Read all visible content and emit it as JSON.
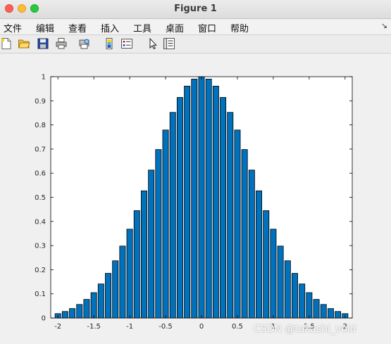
{
  "window": {
    "title": "Figure 1"
  },
  "menubar": {
    "items": [
      "文件",
      "编辑",
      "查看",
      "插入",
      "工具",
      "桌面",
      "窗口",
      "帮助"
    ],
    "dock_glyph": "↘"
  },
  "toolbar": {
    "buttons": [
      "new-figure-icon",
      "open-folder-icon",
      "save-icon",
      "print-icon",
      "print-preview-icon",
      "link-plot-icon",
      "insert-legend-icon",
      "pointer-icon",
      "property-inspector-icon"
    ]
  },
  "colors": {
    "bar_fill": "#0072bd",
    "bar_edge": "#000000",
    "axes_background": "#ffffff",
    "figure_background": "#f0f0f0"
  },
  "chart_data": {
    "type": "bar",
    "x": [
      -2.0,
      -1.9,
      -1.8,
      -1.7,
      -1.6,
      -1.5,
      -1.4,
      -1.3,
      -1.2,
      -1.1,
      -1.0,
      -0.9,
      -0.8,
      -0.7,
      -0.6,
      -0.5,
      -0.4,
      -0.3,
      -0.2,
      -0.1,
      0.0,
      0.1,
      0.2,
      0.3,
      0.4,
      0.5,
      0.6,
      0.7,
      0.8,
      0.9,
      1.0,
      1.1,
      1.2,
      1.3,
      1.4,
      1.5,
      1.6,
      1.7,
      1.8,
      1.9,
      2.0
    ],
    "values": [
      0.018,
      0.027,
      0.039,
      0.056,
      0.077,
      0.105,
      0.141,
      0.185,
      0.237,
      0.298,
      0.368,
      0.445,
      0.527,
      0.613,
      0.698,
      0.779,
      0.852,
      0.914,
      0.961,
      0.99,
      1.0,
      0.99,
      0.961,
      0.914,
      0.852,
      0.779,
      0.698,
      0.613,
      0.527,
      0.445,
      0.368,
      0.298,
      0.237,
      0.185,
      0.141,
      0.105,
      0.077,
      0.056,
      0.039,
      0.027,
      0.018
    ],
    "xlim": [
      -2.1,
      2.1
    ],
    "ylim": [
      0,
      1
    ],
    "xticks": [
      "-2",
      "-1.5",
      "-1",
      "-0.5",
      "0",
      "0.5",
      "1",
      "1.5",
      "2"
    ],
    "xtick_values": [
      -2,
      -1.5,
      -1,
      -0.5,
      0,
      0.5,
      1,
      1.5,
      2
    ],
    "yticks": [
      "0",
      "0.1",
      "0.2",
      "0.3",
      "0.4",
      "0.5",
      "0.6",
      "0.7",
      "0.8",
      "0.9",
      "1"
    ],
    "ytick_values": [
      0,
      0.1,
      0.2,
      0.3,
      0.4,
      0.5,
      0.6,
      0.7,
      0.8,
      0.9,
      1.0
    ],
    "bar_width_fraction": 0.8,
    "grid": false,
    "title": "",
    "xlabel": "",
    "ylabel": ""
  },
  "watermark": "CSDN @takashi_void"
}
